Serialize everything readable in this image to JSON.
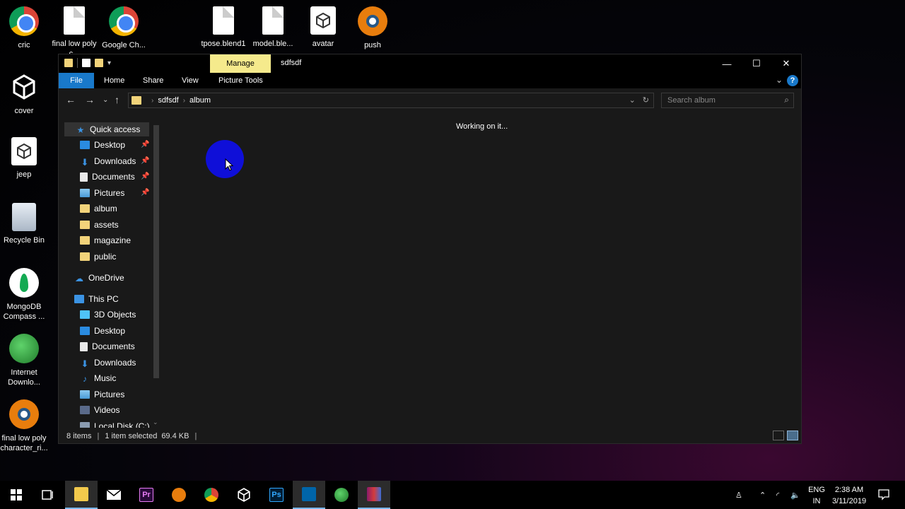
{
  "desktop": {
    "icons": [
      {
        "label": "cric"
      },
      {
        "label": "final low poly c..."
      },
      {
        "label": "Google Ch..."
      },
      {
        "label": "tpose.blend1"
      },
      {
        "label": "model.ble..."
      },
      {
        "label": "avatar"
      },
      {
        "label": "push"
      },
      {
        "label": "cover"
      },
      {
        "label": "jeep"
      },
      {
        "label": "Recycle Bin"
      },
      {
        "label": "MongoDB Compass ..."
      },
      {
        "label": "Internet Downlo..."
      },
      {
        "label": "final low poly character_ri..."
      }
    ]
  },
  "window": {
    "title": "sdfsdf",
    "manage_tab": "Manage",
    "controls": {
      "minimize": "—",
      "maximize": "☐",
      "close": "✕"
    },
    "ribbon": {
      "tabs": [
        "File",
        "Home",
        "Share",
        "View",
        "Picture Tools"
      ],
      "help": "?"
    },
    "address": {
      "crumbs": [
        "sdfsdf",
        "album"
      ],
      "search_placeholder": "Search album"
    },
    "nav": {
      "quick_access": "Quick access",
      "quick_items": [
        {
          "label": "Desktop",
          "icon": "desktop-icon",
          "pinned": true
        },
        {
          "label": "Downloads",
          "icon": "downloads-icon",
          "pinned": true
        },
        {
          "label": "Documents",
          "icon": "documents-icon",
          "pinned": true
        },
        {
          "label": "Pictures",
          "icon": "pictures-icon",
          "pinned": true
        },
        {
          "label": "album",
          "icon": "folder-icon",
          "pinned": false
        },
        {
          "label": "assets",
          "icon": "folder-icon",
          "pinned": false
        },
        {
          "label": "magazine",
          "icon": "folder-icon",
          "pinned": false
        },
        {
          "label": "public",
          "icon": "folder-icon",
          "pinned": false
        }
      ],
      "onedrive": "OneDrive",
      "this_pc": "This PC",
      "pc_items": [
        {
          "label": "3D Objects",
          "icon": "3d-objects-icon"
        },
        {
          "label": "Desktop",
          "icon": "desktop-icon"
        },
        {
          "label": "Documents",
          "icon": "documents-icon"
        },
        {
          "label": "Downloads",
          "icon": "downloads-icon"
        },
        {
          "label": "Music",
          "icon": "music-icon"
        },
        {
          "label": "Pictures",
          "icon": "pictures-icon"
        },
        {
          "label": "Videos",
          "icon": "videos-icon"
        },
        {
          "label": "Local Disk (C:)",
          "icon": "disk-icon"
        }
      ]
    },
    "content": {
      "status_message": "Working on it..."
    },
    "statusbar": {
      "item_count": "8 items",
      "selection": "1 item selected",
      "size": "69.4 KB"
    }
  },
  "taskbar": {
    "apps": [
      {
        "name": "start-button",
        "icon": "windows-icon"
      },
      {
        "name": "task-view",
        "icon": "task-view-icon"
      },
      {
        "name": "file-explorer",
        "icon": "folder-icon",
        "active": true
      },
      {
        "name": "mail",
        "icon": "mail-icon"
      },
      {
        "name": "premiere",
        "icon": "premiere-icon",
        "text": "Pr"
      },
      {
        "name": "blender",
        "icon": "blender-icon"
      },
      {
        "name": "chrome",
        "icon": "chrome-icon"
      },
      {
        "name": "unity",
        "icon": "unity-icon"
      },
      {
        "name": "photoshop",
        "icon": "photoshop-icon",
        "text": "Ps"
      },
      {
        "name": "vscode",
        "icon": "vscode-icon"
      },
      {
        "name": "idm",
        "icon": "idm-icon"
      },
      {
        "name": "winrar",
        "icon": "winrar-icon"
      }
    ],
    "tray": {
      "lang_top": "ENG",
      "lang_bottom": "IN",
      "time": "2:38 AM",
      "date": "3/11/2019"
    }
  },
  "colors": {
    "accent": "#1979ca",
    "manage_tab": "#f5ea8c",
    "window_bg": "#191919",
    "cursor_highlight": "#0f0fd8"
  }
}
